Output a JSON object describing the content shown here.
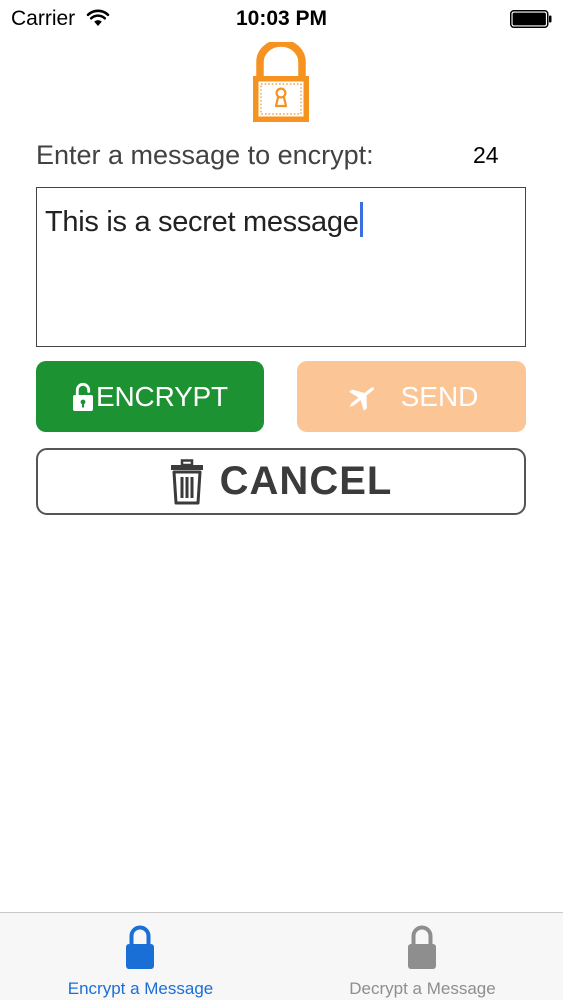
{
  "status_bar": {
    "carrier": "Carrier",
    "time": "10:03 PM"
  },
  "header": {
    "icon": "padlock-icon",
    "accent_color": "#f59220"
  },
  "prompt": {
    "label": "Enter a message to encrypt:",
    "char_count": "24"
  },
  "message": {
    "value": "This is a secret message"
  },
  "buttons": {
    "encrypt_label": "ENCRYPT",
    "encrypt_icon": "unlocked-padlock-icon",
    "encrypt_color": "#1d9233",
    "send_label": "SEND",
    "send_icon": "airplane-icon",
    "send_color": "#fbc596",
    "cancel_label": "CANCEL",
    "cancel_icon": "trash-icon"
  },
  "tab_bar": {
    "tabs": [
      {
        "label": "Encrypt a Message",
        "icon": "lock-icon",
        "selected": true,
        "color": "#1a6fd6"
      },
      {
        "label": "Decrypt a Message",
        "icon": "lock-icon",
        "selected": false,
        "color": "#8e8e8e"
      }
    ]
  }
}
